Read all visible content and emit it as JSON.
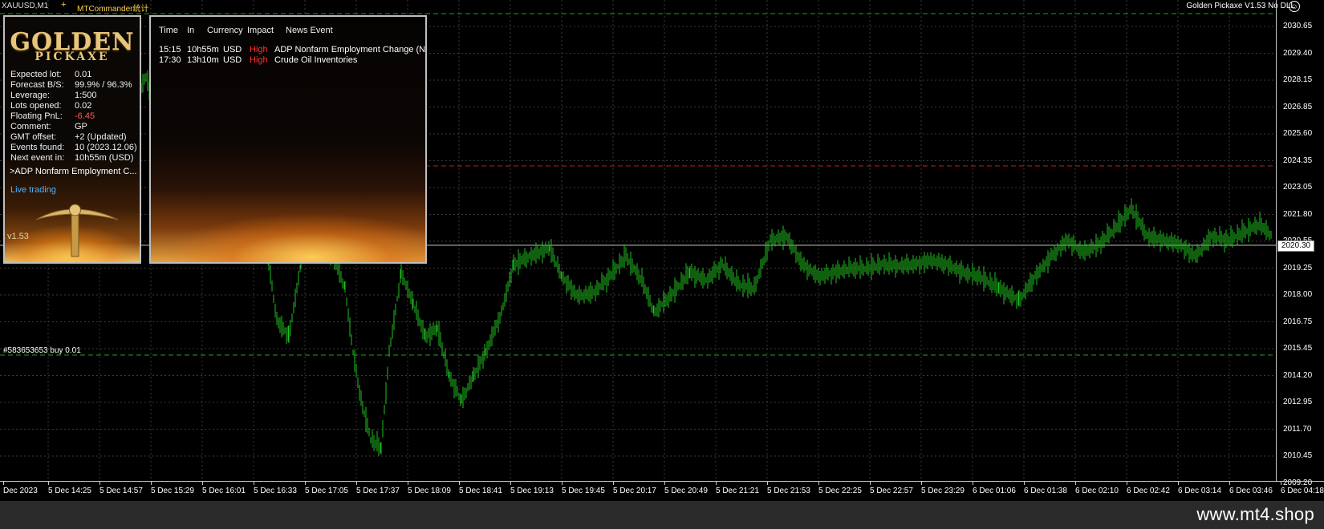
{
  "header": {
    "symbol_label": "XAUUSD,M1",
    "indicator_label": "MTCommander统计",
    "ea_name": "Golden Pickaxe V1.53 No DLL"
  },
  "colors": {
    "background": "#000000",
    "grid": "#3a3a3a",
    "candles": "#1fbf1f",
    "level_lines": "#1f9f1f",
    "resistance_line": "#c02020",
    "news_high": "#ff3030",
    "live_trading": "#4fb3ff"
  },
  "order_label": "#583653653 buy 0.01",
  "current_price": "2020.30",
  "price_axis": [
    "2030.65",
    "2029.40",
    "2028.15",
    "2026.85",
    "2025.60",
    "2024.35",
    "2023.05",
    "2021.80",
    "2020.55",
    "2019.25",
    "2018.00",
    "2016.75",
    "2015.45",
    "2014.20",
    "2012.95",
    "2011.70",
    "2010.45",
    "2009.20"
  ],
  "time_axis": [
    "Dec 2023",
    "5 Dec 14:25",
    "5 Dec 14:57",
    "5 Dec 15:29",
    "5 Dec 16:01",
    "5 Dec 16:33",
    "5 Dec 17:05",
    "5 Dec 17:37",
    "5 Dec 18:09",
    "5 Dec 18:41",
    "5 Dec 19:13",
    "5 Dec 19:45",
    "5 Dec 20:17",
    "5 Dec 20:49",
    "5 Dec 21:21",
    "5 Dec 21:53",
    "5 Dec 22:25",
    "5 Dec 22:57",
    "5 Dec 23:29",
    "6 Dec 01:06",
    "6 Dec 01:38",
    "6 Dec 02:10",
    "6 Dec 02:42",
    "6 Dec 03:14",
    "6 Dec 03:46",
    "6 Dec 04:18"
  ],
  "golden_pickaxe": {
    "logo_line1": "GOLDEN",
    "logo_line2": "PICKAXE",
    "rows": [
      {
        "label": "Expected lot:",
        "value": "0.01"
      },
      {
        "label": "Forecast B/S:",
        "value": "99.9% / 96.3%"
      },
      {
        "label": "Leverage:",
        "value": "1:500"
      },
      {
        "label": "Lots opened:",
        "value": "0.02"
      },
      {
        "label": "Floating PnL:",
        "value": "-6.45"
      },
      {
        "label": "Comment:",
        "value": "GP"
      },
      {
        "label": "GMT offset:",
        "value": "+2 (Updated)"
      },
      {
        "label": "Events found:",
        "value": "10 (2023.12.06)"
      },
      {
        "label": "Next event in:",
        "value": "10h55m (USD)"
      }
    ],
    "next_event_name": ">ADP Nonfarm Employment C...",
    "live_trading": "Live trading",
    "version": "v1.53"
  },
  "news": {
    "headers": {
      "time": "Time",
      "in": "In",
      "currency": "Currency",
      "impact": "Impact",
      "event": "News Event"
    },
    "rows": [
      {
        "time": "15:15",
        "in": "10h55m",
        "currency": "USD",
        "impact": "High",
        "event": "ADP Nonfarm Employment Change (N"
      },
      {
        "time": "17:30",
        "in": "13h10m",
        "currency": "USD",
        "impact": "High",
        "event": "Crude Oil Inventories"
      }
    ]
  },
  "site_url": "www.mt4.shop"
}
